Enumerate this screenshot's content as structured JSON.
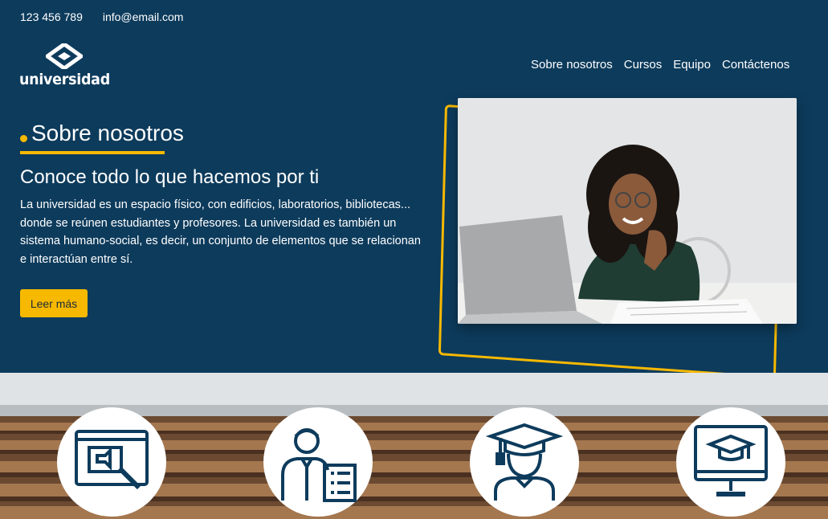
{
  "contact": {
    "phone": "123 456 789",
    "email": "info@email.com"
  },
  "logo": {
    "text": "universidad"
  },
  "nav": {
    "items": [
      "Sobre nosotros",
      "Cursos",
      "Equipo",
      "Contáctenos"
    ]
  },
  "about": {
    "title": "Sobre nosotros",
    "subtitle": "Conoce todo lo que hacemos por ti",
    "description": "La universidad es un espacio físico, con edificios, laboratorios, bibliotecas... donde se reúnen estudiantes y profesores. La universidad es también un sistema humano-social, es decir, un conjunto de elementos que se relacionan e interactúan entre sí.",
    "button_label": "Leer más"
  },
  "features": {
    "icons": [
      "presentation-board-icon",
      "teacher-board-icon",
      "graduate-student-icon",
      "online-course-monitor-icon"
    ]
  },
  "colors": {
    "primary": "#0d3b5c",
    "accent": "#f7b900",
    "white": "#ffffff"
  }
}
